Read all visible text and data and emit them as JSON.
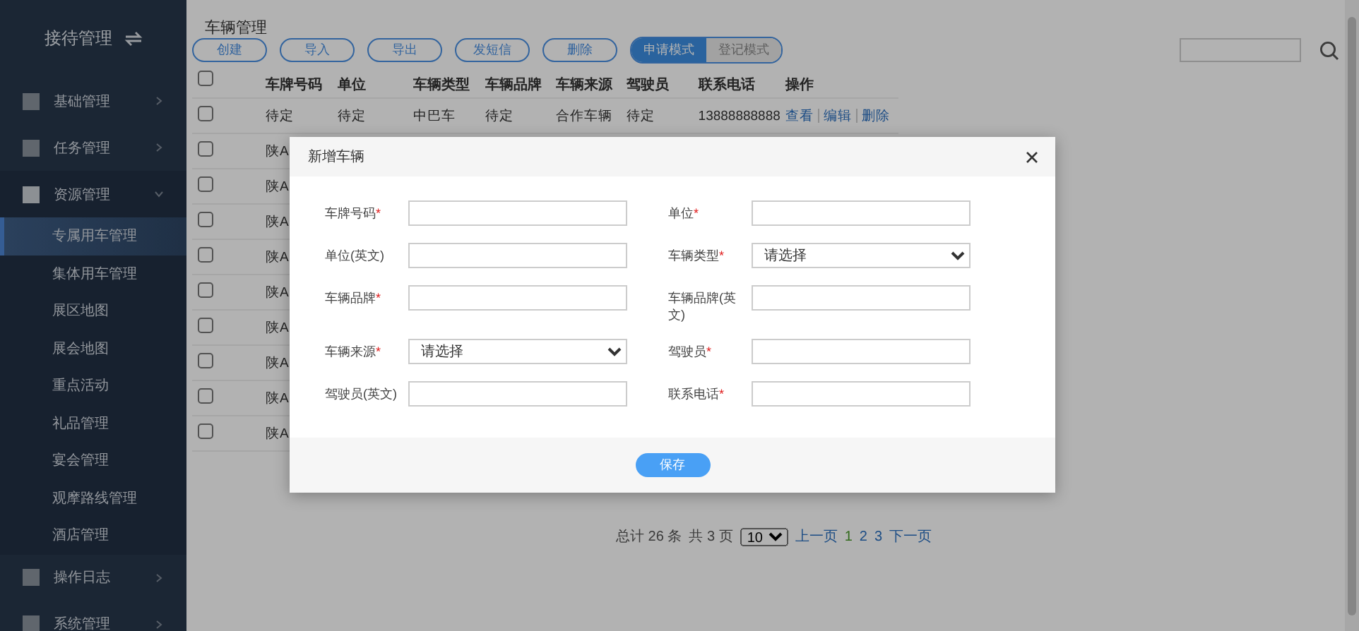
{
  "sidebar": {
    "title": "接待管理",
    "items": [
      {
        "label": "基础管理",
        "expanded": false
      },
      {
        "label": "任务管理",
        "expanded": false
      },
      {
        "label": "资源管理",
        "expanded": true,
        "children": [
          {
            "label": "专属用车管理",
            "selected": true
          },
          {
            "label": "集体用车管理",
            "selected": false
          },
          {
            "label": "展区地图",
            "selected": false
          },
          {
            "label": "展会地图",
            "selected": false
          },
          {
            "label": "重点活动",
            "selected": false
          },
          {
            "label": "礼品管理",
            "selected": false
          },
          {
            "label": "宴会管理",
            "selected": false
          },
          {
            "label": "观摩路线管理",
            "selected": false
          },
          {
            "label": "酒店管理",
            "selected": false
          }
        ]
      },
      {
        "label": "操作日志",
        "expanded": false
      },
      {
        "label": "系统管理",
        "expanded": false
      }
    ]
  },
  "page_title": "车辆管理",
  "toolbar": [
    "创建",
    "导入",
    "导出",
    "发短信",
    "删除"
  ],
  "modes": [
    {
      "label": "申请模式",
      "selected": true
    },
    {
      "label": "登记模式",
      "selected": false
    }
  ],
  "table": {
    "all_checked": false,
    "columns": [
      "车牌号码",
      "单位",
      "车辆类型",
      "车辆品牌",
      "车辆来源",
      "驾驶员",
      "联系电话",
      "操作"
    ],
    "rows": [
      {
        "checked": false,
        "cells": [
          "待定",
          "待定",
          "中巴车",
          "待定",
          "合作车辆",
          "待定",
          "13888888888"
        ],
        "actions": [
          "查看",
          "编辑",
          "删除"
        ]
      },
      {
        "checked": false,
        "cells": [
          "陕A"
        ]
      },
      {
        "checked": false,
        "cells": [
          "陕A"
        ]
      },
      {
        "checked": false,
        "cells": [
          "陕A"
        ]
      },
      {
        "checked": false,
        "cells": [
          "陕A"
        ]
      },
      {
        "checked": false,
        "cells": [
          "陕A"
        ]
      },
      {
        "checked": false,
        "cells": [
          "陕A"
        ]
      },
      {
        "checked": false,
        "cells": [
          "陕A"
        ]
      },
      {
        "checked": false,
        "cells": [
          "陕A"
        ]
      },
      {
        "checked": false,
        "cells": [
          "陕A"
        ]
      }
    ]
  },
  "pagination": {
    "total": "总计 26 条",
    "page_count": "共 3 页",
    "page_size": "10",
    "prev": "上一页",
    "pages": [
      {
        "label": "1",
        "selected": true
      },
      {
        "label": "2",
        "selected": false
      },
      {
        "label": "3",
        "selected": false
      }
    ],
    "next": "下一页"
  },
  "dialog": {
    "title": "新增车辆",
    "fields": [
      {
        "label": "车牌号码",
        "required_mark": "*",
        "kind": "input"
      },
      {
        "label": "单位",
        "required_mark": "*",
        "kind": "input"
      },
      {
        "label": "单位(英文)",
        "kind": "input"
      },
      {
        "label": "车辆类型",
        "required_mark": "*",
        "kind": "select",
        "value": "请选择"
      },
      {
        "label": "车辆品牌",
        "required_mark": "*",
        "kind": "input"
      },
      {
        "label": "车辆品牌(英文)",
        "kind": "input"
      },
      {
        "label": "车辆来源",
        "required_mark": "*",
        "kind": "select",
        "value": "请选择"
      },
      {
        "label": "驾驶员",
        "required_mark": "*",
        "kind": "input"
      },
      {
        "label": "驾驶员(英文)",
        "kind": "input"
      },
      {
        "label": "联系电话",
        "required_mark": "*",
        "kind": "input"
      }
    ],
    "save": "保存"
  }
}
